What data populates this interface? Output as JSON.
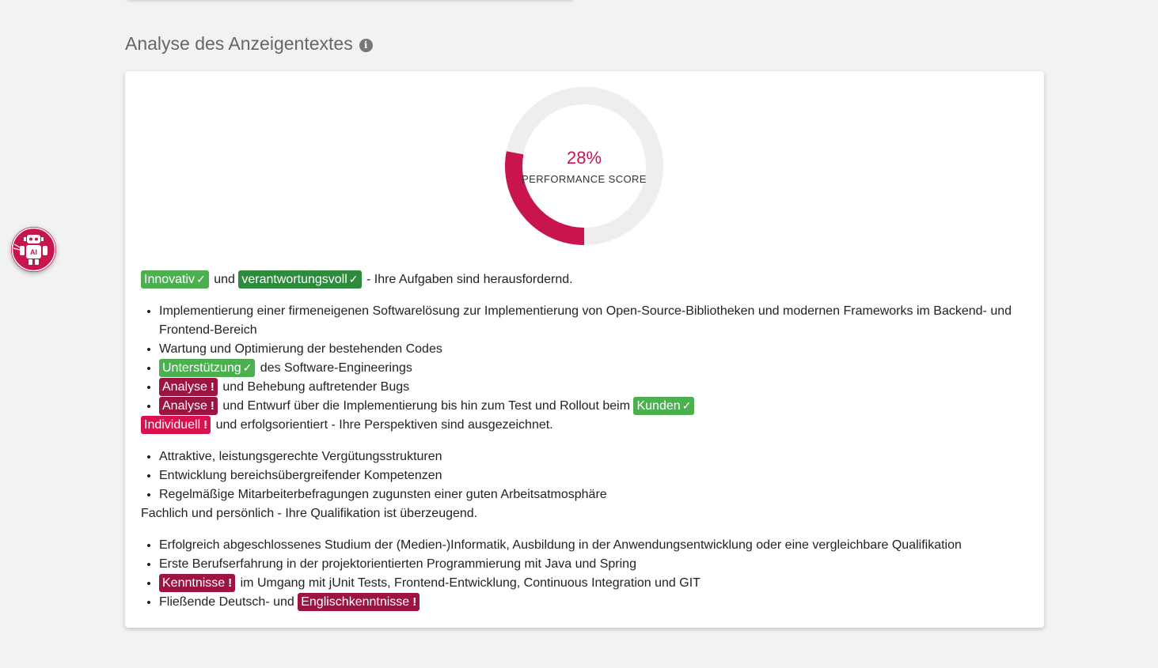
{
  "section": {
    "title": "Analyse des Anzeigentextes",
    "info_icon": "info-icon"
  },
  "score": {
    "value": "28%",
    "fraction": 0.28,
    "label": "PERFORMANCE SCORE",
    "color": "#c8154d",
    "track_color": "#eeeeee"
  },
  "assistant": {
    "icon": "robot-ai-icon",
    "badge": "AI"
  },
  "colors": {
    "ok": "#4caf50",
    "ok_dark": "#2e8b3d",
    "warn": "#9c1540",
    "alert": "#d8124e"
  },
  "content": {
    "intro1": {
      "tag1": "Innovativ",
      "mid": "und",
      "tag2": "verantwortungsvoll",
      "rest": "- Ihre Aufgaben sind herausfordernd."
    },
    "list1": {
      "item1": "Implementierung einer firmeneigenen Softwarelösung zur Implementierung von Open-Source-Bibliotheken und modernen Frameworks im Backend- und Frontend-Bereich",
      "item2": "Wartung und Optimierung der bestehenden Codes",
      "item3_tag": "Unterstützung",
      "item3_rest": "des Software-Engineerings",
      "item4_tag": "Analyse",
      "item4_rest": "und Behebung auftretender Bugs",
      "item5_tag": "Analyse",
      "item5_rest": "und Entwurf über die Implementierung bis hin zum Test und Rollout beim",
      "item5_tag2": "Kunden"
    },
    "intro2": {
      "tag": "Individuell",
      "rest": "und erfolgsorientiert - Ihre Perspektiven sind ausgezeichnet."
    },
    "list2": [
      "Attraktive, leistungsgerechte Vergütungsstrukturen",
      "Entwicklung bereichsübergreifender Kompetenzen",
      "Regelmäßige Mitarbeiterbefragungen zugunsten einer guten Arbeitsatmosphäre"
    ],
    "intro3": "Fachlich und persönlich - Ihre Qualifikation ist überzeugend.",
    "list3": {
      "item1": "Erfolgreich abgeschlossenes Studium der (Medien-)Informatik, Ausbildung in der Anwendungsentwicklung oder eine vergleichbare Qualifikation",
      "item2": "Erste Berufserfahrung in der projektorientierten Programmierung mit Java und Spring",
      "item3_tag": "Kenntnisse",
      "item3_rest": "im Umgang mit jUnit Tests, Frontend-Entwicklung, Continuous Integration und GIT",
      "item4_pre": "Fließende Deutsch- und",
      "item4_tag": "Englischkenntnisse"
    },
    "marks": {
      "check": "✓",
      "warn": "!"
    }
  }
}
